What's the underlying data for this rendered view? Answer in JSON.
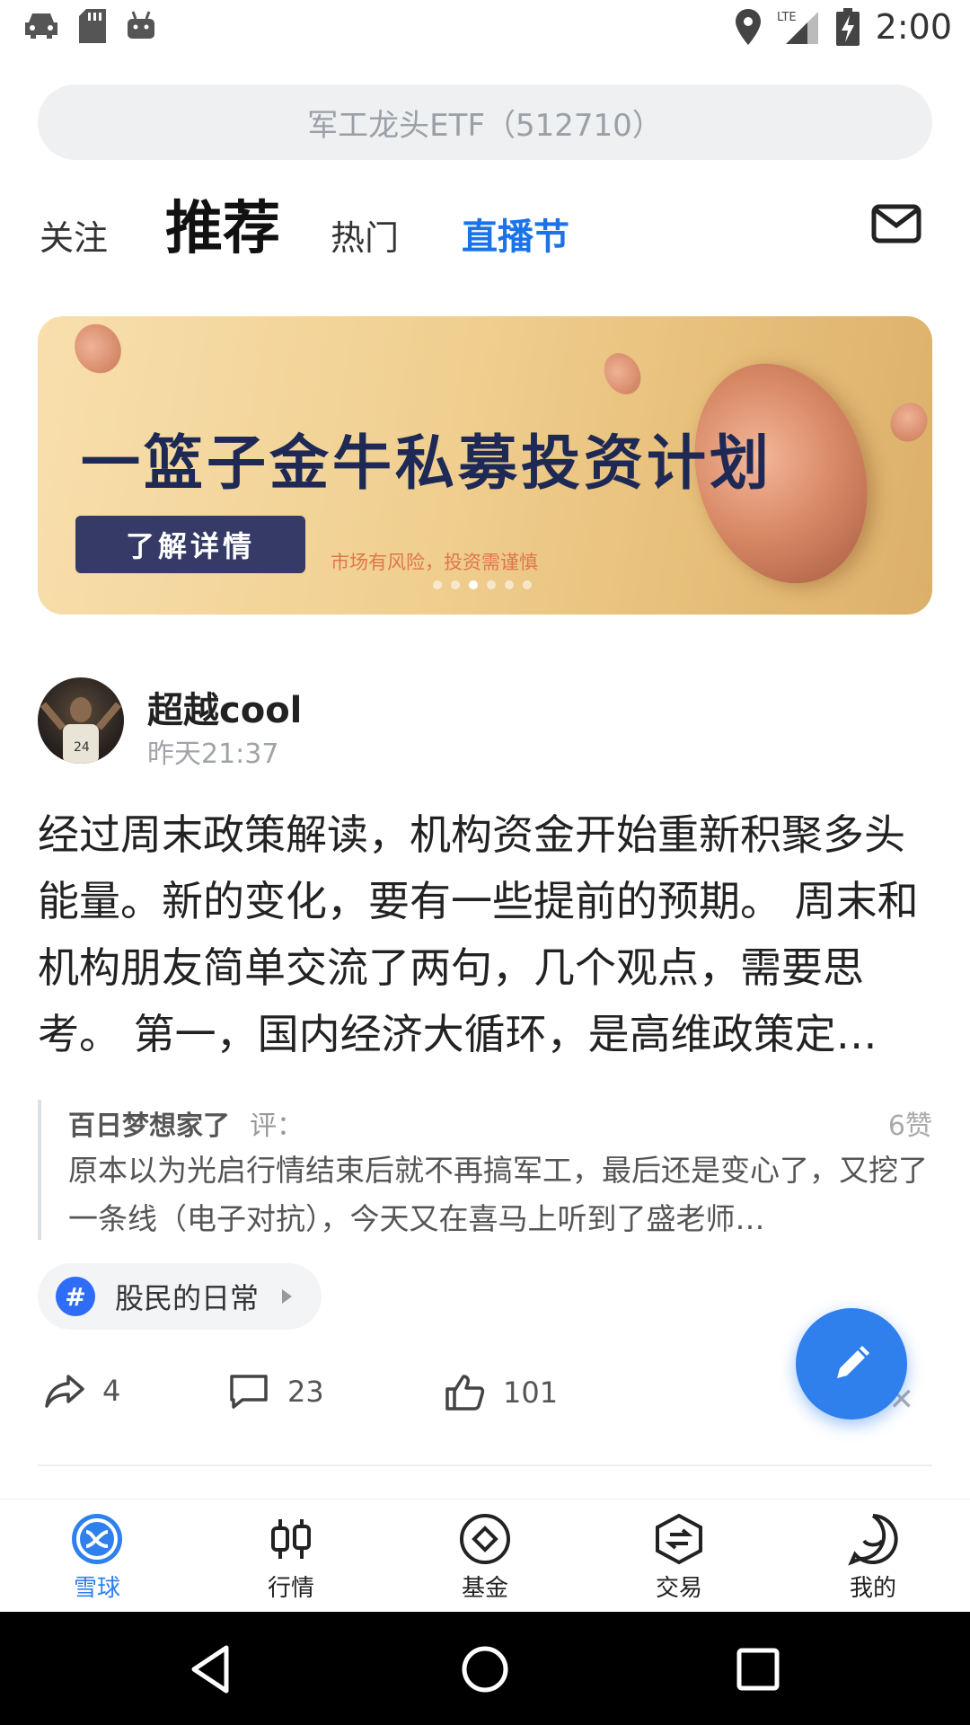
{
  "status_bar": {
    "time": "2:00",
    "network": "LTE"
  },
  "search": {
    "placeholder": "军工龙头ETF（512710）"
  },
  "tabs": [
    {
      "label": "关注"
    },
    {
      "label": "推荐"
    },
    {
      "label": "热门"
    },
    {
      "label": "直播节"
    }
  ],
  "banner": {
    "title": "一篮子金牛私募投资计划",
    "button_label": "了解详情",
    "risk_note": "市场有风险，投资需谨慎",
    "carousel_count": 6,
    "carousel_active_index": 2
  },
  "post": {
    "username": "超越cool",
    "time": "昨天21:37",
    "content": "经过周末政策解读，机构资金开始重新积聚多头能量。新的变化，要有一些提前的预期。 周末和机构朋友简单交流了两句，几个观点，需要思考。 第一，国内经济大循环，是高维政策定…",
    "quote": {
      "user": "百日梦想家了",
      "label": "评：",
      "likes": "6赞",
      "text": "原本以为光启行情结束后就不再搞军工，最后还是变心了，又挖了一条线（电子对抗），今天又在喜马上听到了盛老师…"
    },
    "topic": {
      "icon": "#",
      "label": "股民的日常"
    },
    "actions": {
      "shares": "4",
      "comments": "23",
      "likes": "101"
    }
  },
  "bottom_nav": [
    {
      "label": "雪球",
      "icon": "snowball-icon",
      "active": true
    },
    {
      "label": "行情",
      "icon": "candlestick-icon",
      "active": false
    },
    {
      "label": "基金",
      "icon": "fund-diamond-icon",
      "active": false
    },
    {
      "label": "交易",
      "icon": "trade-icon",
      "active": false
    },
    {
      "label": "我的",
      "icon": "profile-smile-icon",
      "active": false
    }
  ],
  "colors": {
    "accent": "#2f80ed",
    "live_tab": "#1a73e8",
    "banner_button": "#363a66"
  }
}
